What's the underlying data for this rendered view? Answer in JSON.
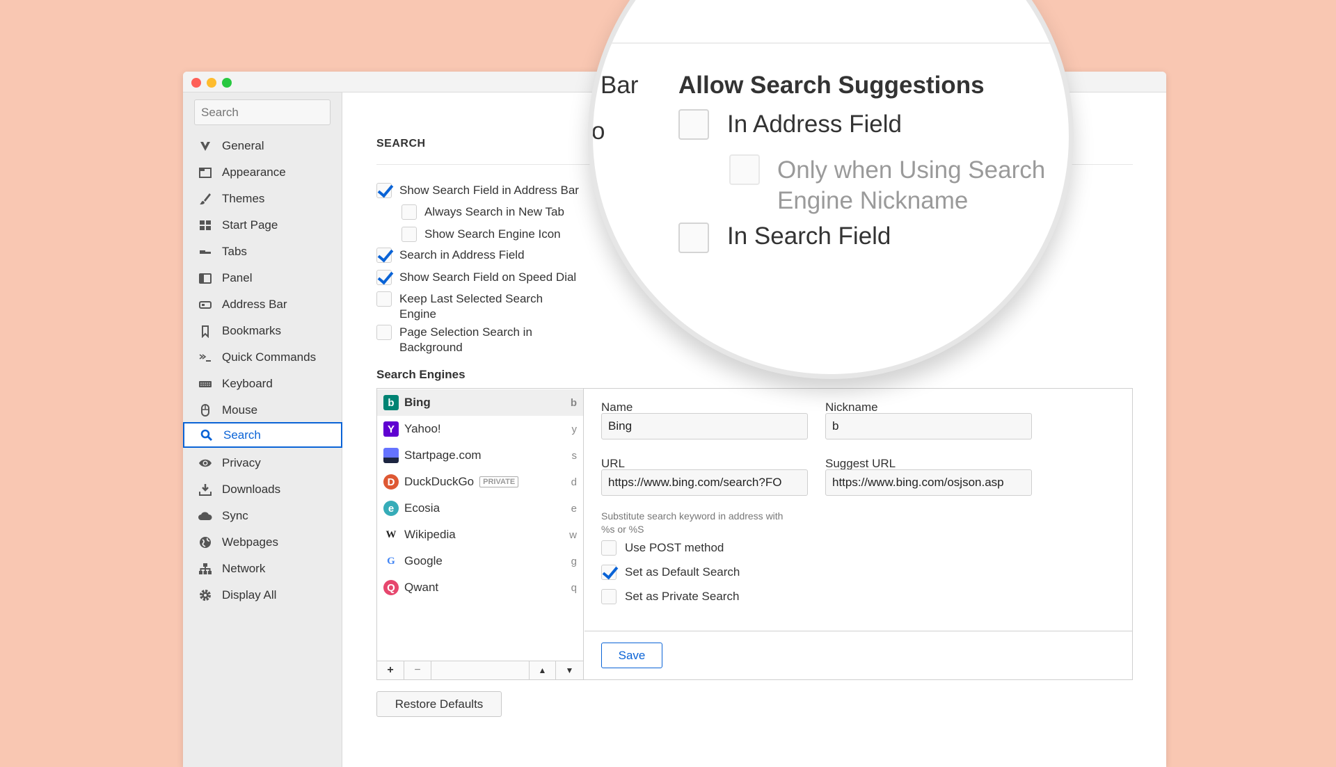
{
  "sidebar": {
    "search_placeholder": "Search",
    "items": [
      {
        "label": "General",
        "icon": "vivaldi-logo-icon"
      },
      {
        "label": "Appearance",
        "icon": "window-icon"
      },
      {
        "label": "Themes",
        "icon": "brush-icon"
      },
      {
        "label": "Start Page",
        "icon": "grid-icon"
      },
      {
        "label": "Tabs",
        "icon": "tabs-icon"
      },
      {
        "label": "Panel",
        "icon": "panel-icon"
      },
      {
        "label": "Address Bar",
        "icon": "address-bar-icon"
      },
      {
        "label": "Bookmarks",
        "icon": "bookmark-icon"
      },
      {
        "label": "Quick Commands",
        "icon": "terminal-icon"
      },
      {
        "label": "Keyboard",
        "icon": "keyboard-icon"
      },
      {
        "label": "Mouse",
        "icon": "mouse-icon"
      },
      {
        "label": "Search",
        "icon": "search-icon",
        "selected": true
      },
      {
        "label": "Privacy",
        "icon": "eye-icon"
      },
      {
        "label": "Downloads",
        "icon": "download-icon"
      },
      {
        "label": "Sync",
        "icon": "cloud-icon"
      },
      {
        "label": "Webpages",
        "icon": "globe-icon"
      },
      {
        "label": "Network",
        "icon": "network-icon"
      },
      {
        "label": "Display All",
        "icon": "gear-icon"
      }
    ]
  },
  "main": {
    "section_title": "SEARCH",
    "options": [
      {
        "label": "Show Search Field in Address Bar",
        "checked": true,
        "indent": false
      },
      {
        "label": "Always Search in New Tab",
        "checked": false,
        "indent": true
      },
      {
        "label": "Show Search Engine Icon",
        "checked": false,
        "indent": true
      },
      {
        "label": "Search in Address Field",
        "checked": true,
        "indent": false
      },
      {
        "label": "Show Search Field on Speed Dial",
        "checked": true,
        "indent": false
      },
      {
        "label": "Keep Last Selected Search Engine",
        "line1": "Keep Last Selected Search",
        "line2": "Engine",
        "checked": false,
        "indent": false
      },
      {
        "label": "Page Selection Search in Background",
        "line1": "Page Selection Search in",
        "line2": "Background",
        "checked": false,
        "indent": false
      }
    ],
    "engines_title": "Search Engines",
    "engines": [
      {
        "name": "Bing",
        "shortcut": "b",
        "selected": true,
        "color": "#008373",
        "glyph": "b"
      },
      {
        "name": "Yahoo!",
        "shortcut": "y",
        "color": "#5f01d1",
        "glyph": "Y"
      },
      {
        "name": "Startpage.com",
        "shortcut": "s",
        "color": "#6573ff",
        "glyph": ""
      },
      {
        "name": "DuckDuckGo",
        "shortcut": "d",
        "badge": "PRIVATE",
        "color": "#de5833",
        "glyph": "D"
      },
      {
        "name": "Ecosia",
        "shortcut": "e",
        "color": "#36acb8",
        "glyph": "e"
      },
      {
        "name": "Wikipedia",
        "shortcut": "w",
        "color": "#ffffff",
        "glyph": "W"
      },
      {
        "name": "Google",
        "shortcut": "g",
        "color": "#ffffff",
        "glyph": "G"
      },
      {
        "name": "Qwant",
        "shortcut": "q",
        "color": "#e6466d",
        "glyph": "Q"
      }
    ],
    "list_toolbar": {
      "add": "+",
      "remove": "−",
      "up": "▲",
      "down": "▼"
    },
    "detail": {
      "name_label": "Name",
      "name_value": "Bing",
      "nickname_label": "Nickname",
      "nickname_value": "b",
      "url_label": "URL",
      "url_value": "https://www.bing.com/search?FO",
      "suggest_label": "Suggest URL",
      "suggest_value": "https://www.bing.com/osjson.asp",
      "hint": "Substitute search keyword in address with",
      "hint2": "%s or %S",
      "use_post": {
        "label": "Use POST method",
        "checked": false
      },
      "default": {
        "label": "Set as Default Search",
        "checked": true
      },
      "private": {
        "label": "Set as Private Search",
        "checked": false
      },
      "save": "Save"
    },
    "restore": "Restore Defaults"
  },
  "magnifier": {
    "partial_left": "Bar",
    "partial_left2": "o",
    "title": "Allow Search Suggestions",
    "in_address": "In Address Field",
    "only_when1": "Only when Using Search",
    "only_when2": "Engine Nickname",
    "in_search": "In Search Field"
  },
  "colors": {
    "accent": "#0a63d6",
    "background": "#f9c7b2",
    "sidebar": "#ececec"
  }
}
